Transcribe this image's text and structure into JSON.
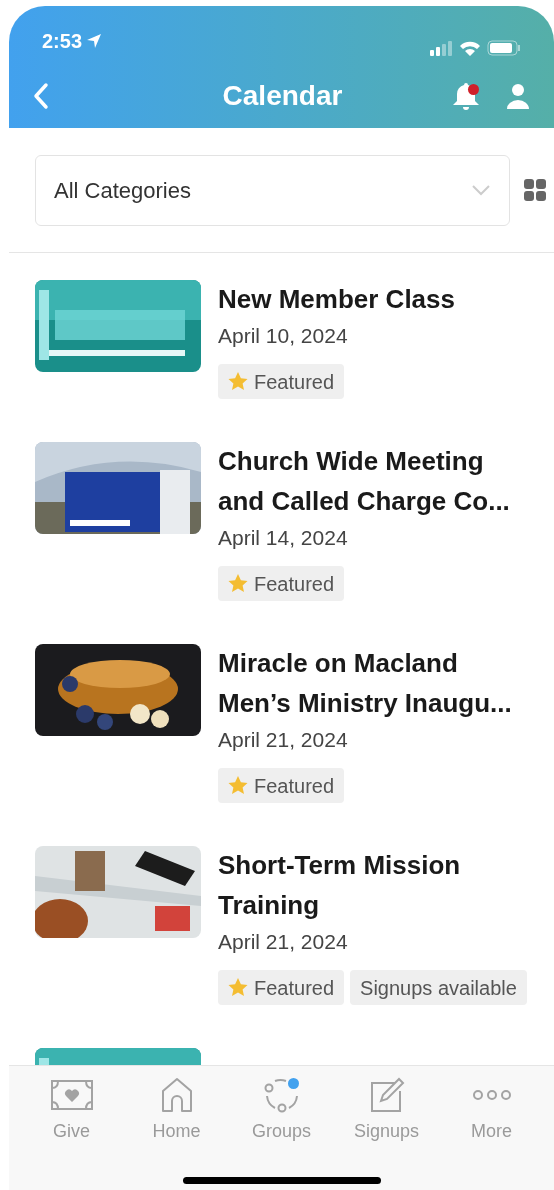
{
  "status_bar": {
    "time": "2:53"
  },
  "nav": {
    "title": "Calendar",
    "has_notification": true
  },
  "filter": {
    "value": "All Categories"
  },
  "events": [
    {
      "title": "New Member Class",
      "date": "April 10, 2024",
      "tags": [
        {
          "kind": "featured",
          "label": "Featured"
        }
      ]
    },
    {
      "title": "Church Wide Meeting and Called Charge Co...",
      "date": "April 14, 2024",
      "tags": [
        {
          "kind": "featured",
          "label": "Featured"
        }
      ]
    },
    {
      "title": "Miracle on Macland Men’s Ministry Inaugu...",
      "date": "April 21, 2024",
      "tags": [
        {
          "kind": "featured",
          "label": "Featured"
        }
      ]
    },
    {
      "title": "Short-Term Mission Training",
      "date": "April 21, 2024",
      "tags": [
        {
          "kind": "featured",
          "label": "Featured"
        },
        {
          "kind": "plain",
          "label": "Signups available"
        }
      ]
    }
  ],
  "tab_bar": [
    {
      "kind": "give",
      "label": "Give",
      "badge": false
    },
    {
      "kind": "home",
      "label": "Home",
      "badge": false
    },
    {
      "kind": "groups",
      "label": "Groups",
      "badge": true
    },
    {
      "kind": "signups",
      "label": "Signups",
      "badge": false
    },
    {
      "kind": "more",
      "label": "More",
      "badge": false
    }
  ]
}
